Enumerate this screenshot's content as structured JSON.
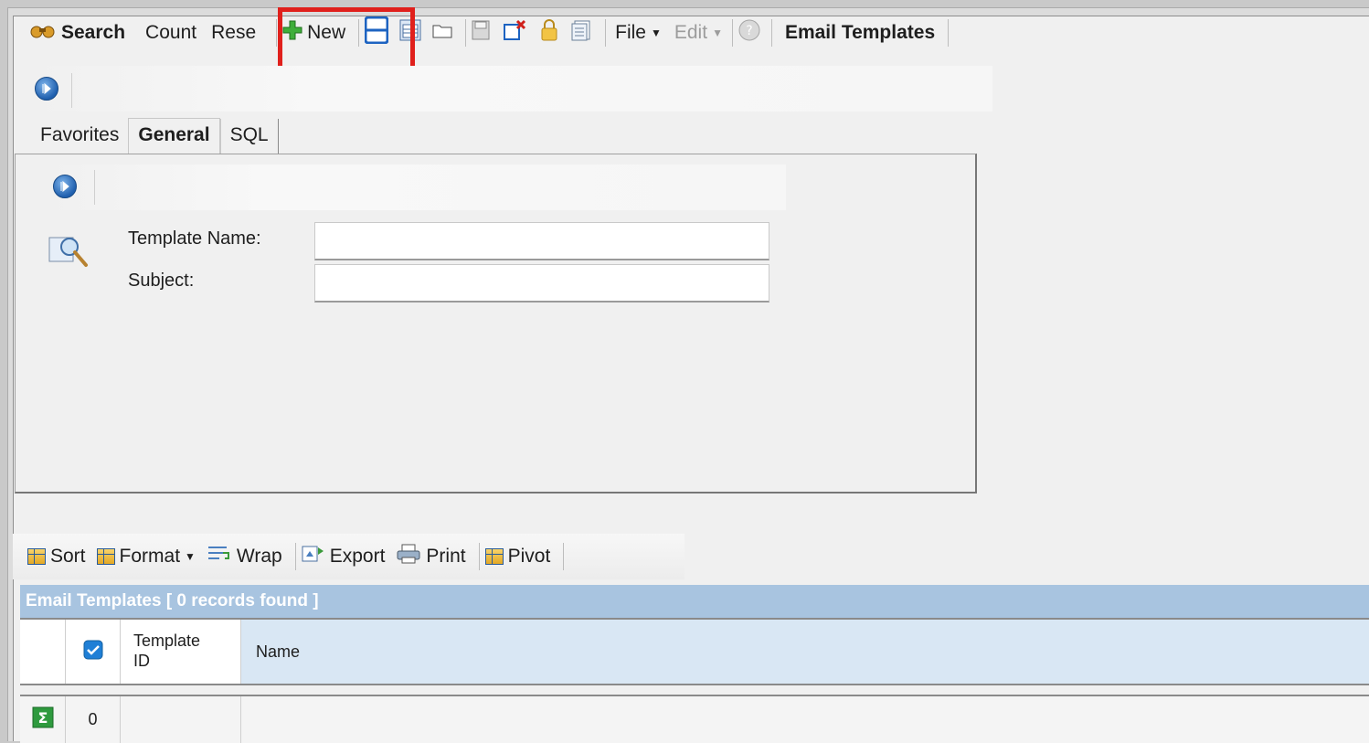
{
  "toolbar": {
    "search": "Search",
    "count": "Count",
    "reset": "Rese",
    "new": "New",
    "file": "File",
    "edit": "Edit",
    "title": "Email Templates"
  },
  "tabs": {
    "favorites": "Favorites",
    "general": "General",
    "sql": "SQL"
  },
  "form": {
    "template_name_label": "Template Name:",
    "template_name_value": "",
    "subject_label": "Subject:",
    "subject_value": ""
  },
  "grid_toolbar": {
    "sort": "Sort",
    "format": "Format",
    "wrap": "Wrap",
    "export": "Export",
    "print": "Print",
    "pivot": "Pivot"
  },
  "grid": {
    "caption": "Email Templates [ 0 records found ]",
    "columns": [
      "Template ID",
      "Name"
    ],
    "column_template_id_line1": "Template",
    "column_template_id_line2": "ID",
    "column_name": "Name",
    "footer_count": "0"
  },
  "colors": {
    "highlight": "#e0201c",
    "grid_caption_bg": "#a8c4e0",
    "nav_button": "#1f5fae"
  }
}
